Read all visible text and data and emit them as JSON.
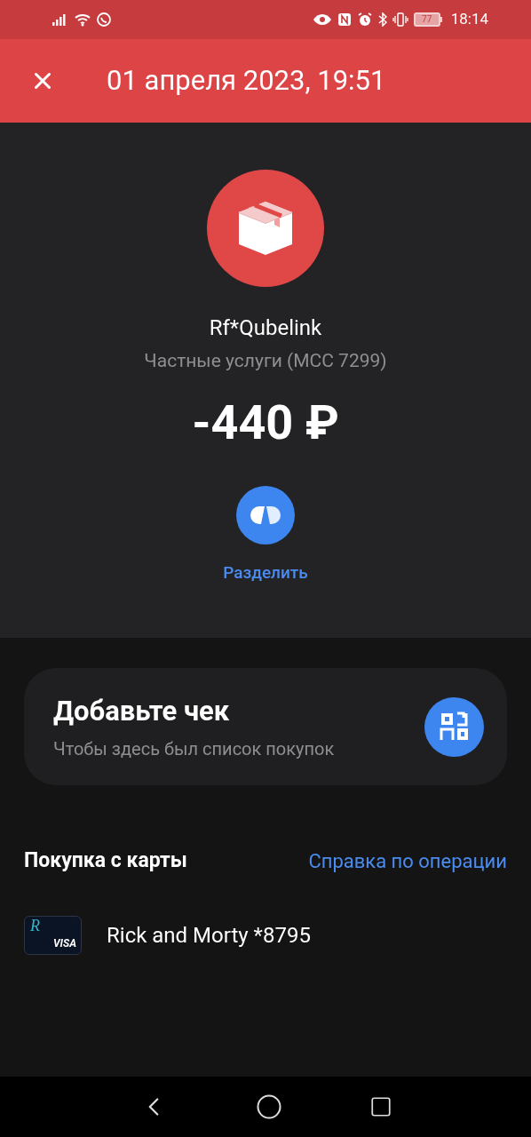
{
  "status_bar": {
    "battery": "77",
    "time": "18:14"
  },
  "header": {
    "title": "01 апреля 2023, 19:51"
  },
  "merchant": {
    "name": "Rf*Qubelink",
    "category": "Частные услуги (MCC 7299)",
    "amount": "-440 ₽"
  },
  "split_action": {
    "label": "Разделить"
  },
  "receipt_card": {
    "title": "Добавьте чек",
    "subtitle": "Чтобы здесь был список покупок"
  },
  "payment": {
    "title": "Покупка с карты",
    "help_link": "Справка по операции"
  },
  "card": {
    "logo_letter": "R",
    "network": "VISA",
    "name": "Rick and Morty *8795"
  }
}
